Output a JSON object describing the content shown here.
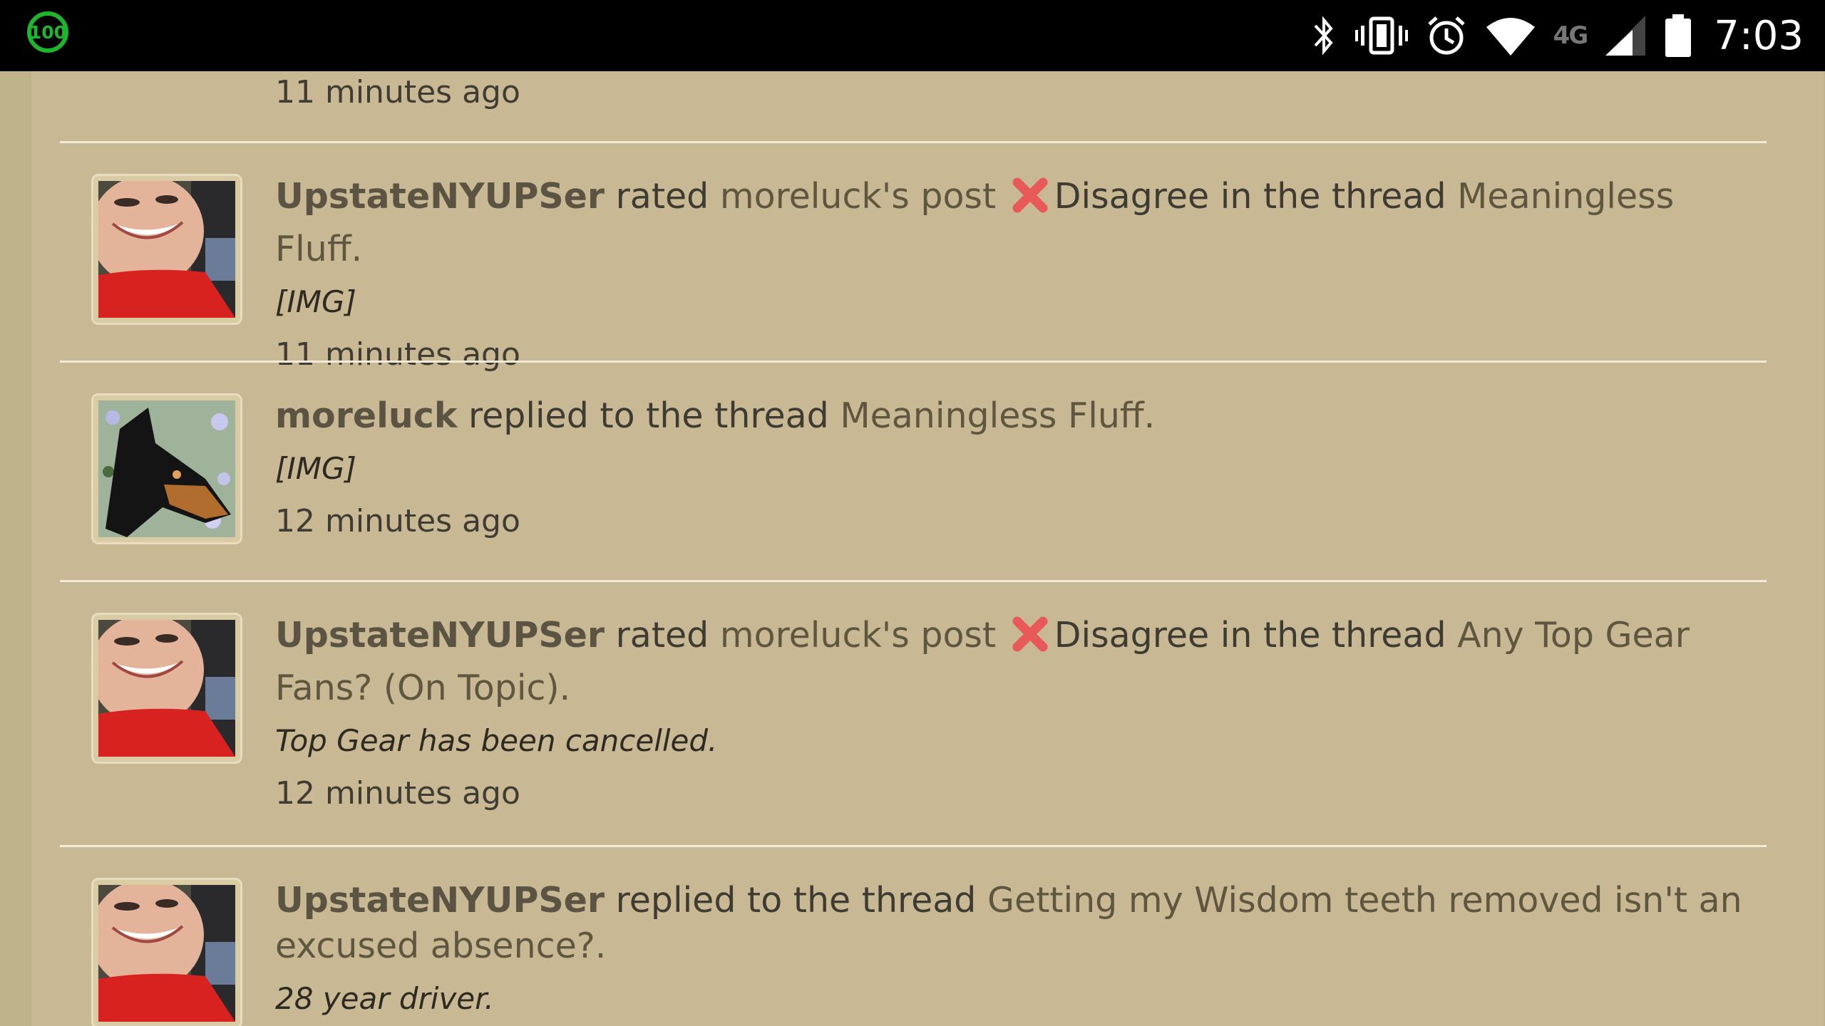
{
  "status_bar": {
    "battery_badge": "100",
    "network": "4G",
    "time": "7:03"
  },
  "top_partial": {
    "time": "11 minutes ago"
  },
  "items": [
    {
      "user": "UpstateNYUPSer",
      "verb": "rated",
      "post_owner": "moreluck's post",
      "rating": "Disagree",
      "in_thread": "in the thread",
      "thread": "Meaningless Fluff.",
      "snippet": "[IMG]",
      "time": "11 minutes ago"
    },
    {
      "user": "moreluck",
      "verb": "replied to the thread",
      "thread": "Meaningless Fluff.",
      "snippet": "[IMG]",
      "time": "12 minutes ago"
    },
    {
      "user": "UpstateNYUPSer",
      "verb": "rated",
      "post_owner": "moreluck's post",
      "rating": "Disagree",
      "in_thread": "in the thread",
      "thread": "Any Top Gear Fans? (On Topic).",
      "snippet": "Top Gear has been cancelled.",
      "time": "12 minutes ago"
    },
    {
      "user": "UpstateNYUPSer",
      "verb": "replied to the thread",
      "thread": "Getting my Wisdom teeth removed isn't an excused absence?.",
      "snippet": "28 year driver."
    }
  ],
  "colors": {
    "page_bg": "#c8b994",
    "outer_bg": "#bfb38c",
    "divider": "#f2ebd9",
    "battery_green": "#1fb52c",
    "disagree_red": "#e85a5a"
  }
}
